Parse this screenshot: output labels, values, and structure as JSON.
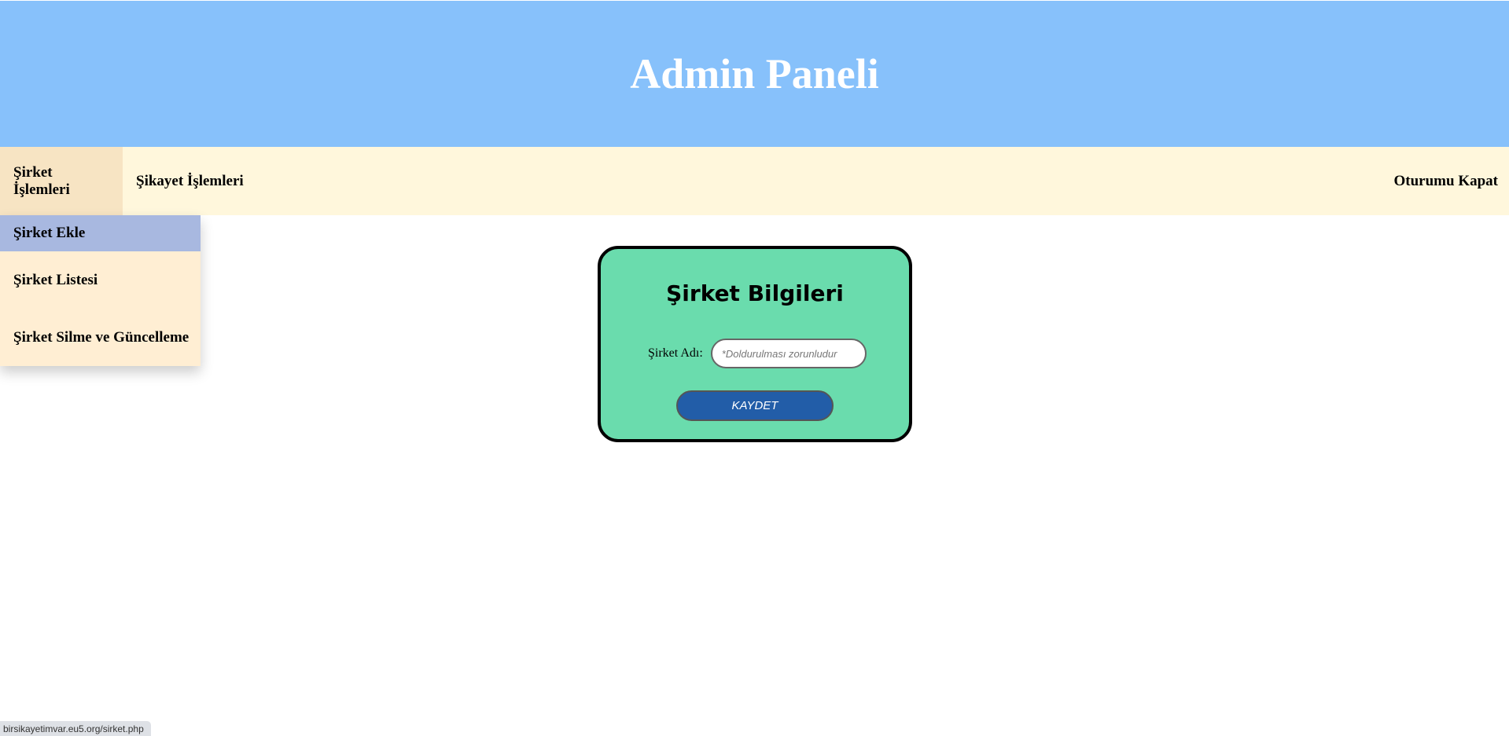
{
  "header": {
    "title": "Admin Paneli"
  },
  "nav": {
    "items": [
      {
        "label": "Şirket İşlemleri"
      },
      {
        "label": "Şikayet İşlemleri"
      }
    ],
    "logout": "Oturumu Kapat"
  },
  "dropdown": {
    "items": [
      {
        "label": "Şirket Ekle"
      },
      {
        "label": "Şirket Listesi"
      },
      {
        "label": "Şirket Silme ve Güncelleme"
      }
    ]
  },
  "form": {
    "title": "Şirket Bilgileri",
    "name_label": "Şirket Adı:",
    "name_value": "",
    "name_placeholder": "*Doldurulması zorunludur",
    "submit": "KAYDET"
  },
  "status_bar": {
    "url": "birsikayetimvar.eu5.org/sirket.php"
  },
  "colors": {
    "header": "#87c1fb",
    "nav": "#fff7dc",
    "card": "#6adcad",
    "button": "#225da8",
    "dropdown_selected": "#a8b8e0"
  }
}
